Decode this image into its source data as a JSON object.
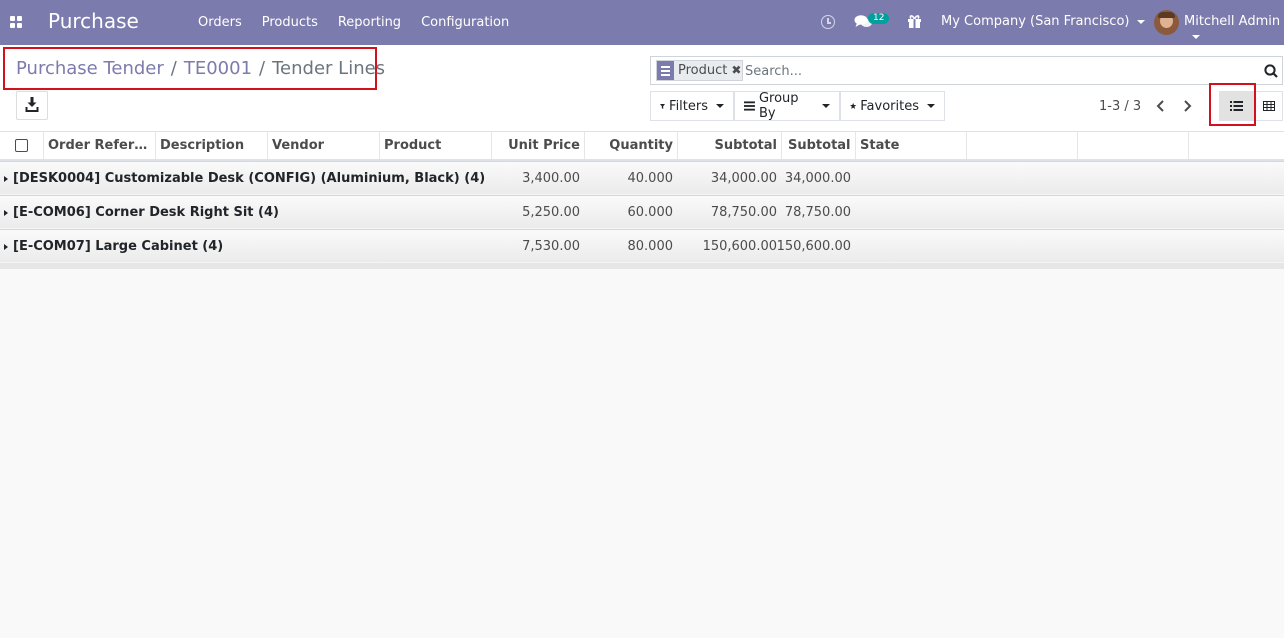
{
  "navbar": {
    "app_name": "Purchase",
    "menu": [
      "Orders",
      "Products",
      "Reporting",
      "Configuration"
    ],
    "message_count": "12",
    "company": "My Company (San Francisco)",
    "user": "Mitchell Admin"
  },
  "breadcrumb": {
    "items": [
      "Purchase Tender",
      "TE0001"
    ],
    "current": "Tender Lines",
    "separator": "/"
  },
  "search": {
    "facet": "Product",
    "placeholder": "Search..."
  },
  "buttons": {
    "filters": "Filters",
    "group_by": "Group By",
    "favorites": "Favorites"
  },
  "pager": {
    "value": "1-3 / 3"
  },
  "table": {
    "columns": [
      "Order Referen…",
      "Description",
      "Vendor",
      "Product",
      "Unit Price",
      "Quantity",
      "Subtotal",
      "Subtotal",
      "State"
    ],
    "groups": [
      {
        "title": "[DESK0004] Customizable Desk (CONFIG) (Aluminium, Black) (4)",
        "unit_price": "3,400.00",
        "quantity": "40.000",
        "subtotal": "34,000.00",
        "subtotal2": "34,000.00"
      },
      {
        "title": "[E-COM06] Corner Desk Right Sit (4)",
        "unit_price": "5,250.00",
        "quantity": "60.000",
        "subtotal": "78,750.00",
        "subtotal2": "78,750.00"
      },
      {
        "title": "[E-COM07] Large Cabinet (4)",
        "unit_price": "7,530.00",
        "quantity": "80.000",
        "subtotal": "150,600.00",
        "subtotal2": "150,600.00"
      }
    ]
  },
  "colors": {
    "brand": "#7c7bad",
    "highlight": "#d3111c",
    "badge": "#00a09d"
  }
}
